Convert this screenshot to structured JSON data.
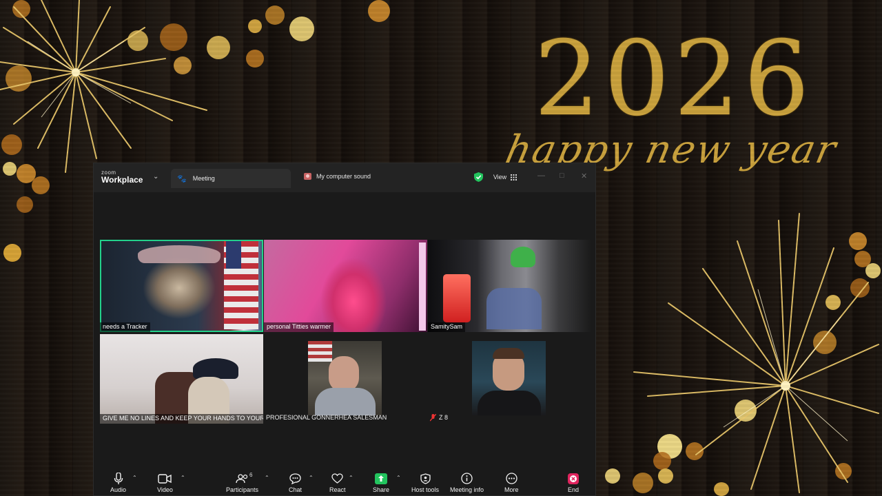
{
  "wallpaper": {
    "year": "2026",
    "greeting": "happy new year",
    "accent": "#c9a13c"
  },
  "window": {
    "logo_small": "zoom",
    "logo_big": "Workplace",
    "tab_meeting": "Meeting",
    "tab_sound": "My computer sound",
    "view_label": "View",
    "security_color": "#23c45e"
  },
  "participants": [
    {
      "name": "needs a Tracker",
      "active_speaker": true
    },
    {
      "name": "personal Titties warmer"
    },
    {
      "name": "SamitySam"
    },
    {
      "name": "GIVE ME NO LINES AND KEEP YOUR HANDS TO YOURSELF"
    },
    {
      "name": "PROFESIONAL GONNERHEA SALESMAN"
    },
    {
      "name": "Z 8",
      "muted": true
    },
    {
      "name": ""
    }
  ],
  "toolbar": {
    "audio": "Audio",
    "video": "Video",
    "participants": "Participants",
    "participants_count": "6",
    "chat": "Chat",
    "react": "React",
    "share": "Share",
    "host_tools": "Host tools",
    "meeting_info": "Meeting info",
    "more": "More",
    "end": "End",
    "share_color": "#23c45e",
    "end_color": "#e0245e"
  }
}
